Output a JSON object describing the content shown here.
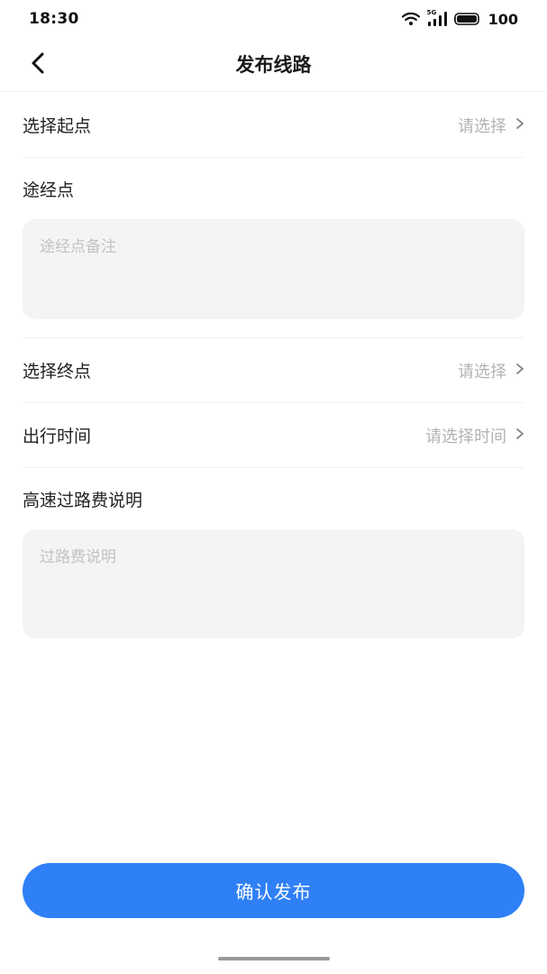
{
  "status_bar": {
    "time": "18:30",
    "network_label": "5G",
    "battery": "100",
    "icons": [
      "wifi-icon",
      "signal-icon",
      "battery-icon"
    ]
  },
  "nav": {
    "back_icon": "chevron-left-icon",
    "title": "发布线路"
  },
  "form": {
    "start": {
      "label": "选择起点",
      "placeholder": "请选择"
    },
    "waypoints": {
      "label": "途经点",
      "placeholder": "途经点备注"
    },
    "end": {
      "label": "选择终点",
      "placeholder": "请选择"
    },
    "departure_time": {
      "label": "出行时间",
      "placeholder": "请选择时间"
    },
    "toll": {
      "label": "高速过路费说明",
      "placeholder": "过路费说明"
    }
  },
  "confirm_button": {
    "label": "确认发布"
  },
  "colors": {
    "accent": "#2f80f6",
    "placeholder": "#b3b3b3",
    "input_bg": "#f4f4f4"
  }
}
